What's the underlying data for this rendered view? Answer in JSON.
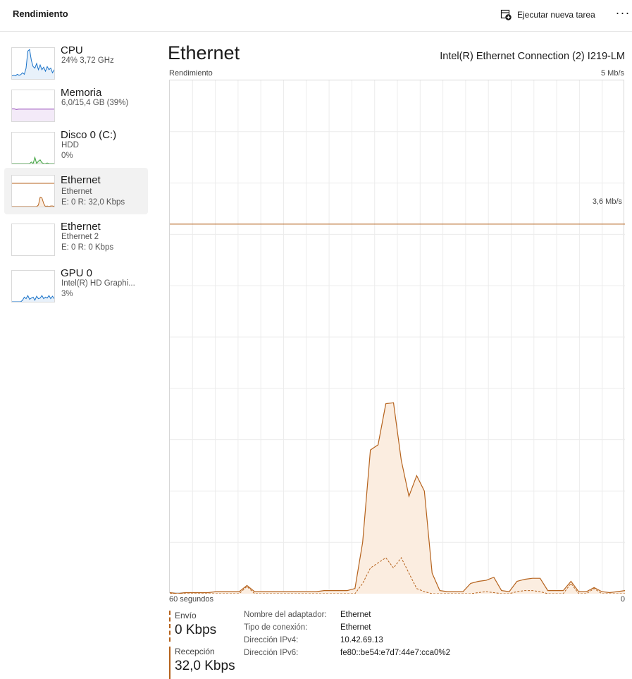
{
  "header": {
    "title": "Rendimiento",
    "run_task_label": "Ejecutar nueva tarea",
    "more_label": "···"
  },
  "sidebar": {
    "items": [
      {
        "name": "CPU",
        "line1": "24%  3,72 GHz",
        "line2": "",
        "color": "#1a73c9",
        "selected": false
      },
      {
        "name": "Memoria",
        "line1": "6,0/15,4 GB (39%)",
        "line2": "",
        "color": "#8e3fb5",
        "selected": false
      },
      {
        "name": "Disco 0 (C:)",
        "line1": "HDD",
        "line2": "0%",
        "color": "#3fa33f",
        "selected": false
      },
      {
        "name": "Ethernet",
        "line1": "Ethernet",
        "line2": "E: 0  R: 32,0 Kbps",
        "color": "#b5621c",
        "selected": true
      },
      {
        "name": "Ethernet",
        "line1": "Ethernet 2",
        "line2": "E: 0  R: 0 Kbps",
        "color": "#b5621c",
        "selected": false
      },
      {
        "name": "GPU 0",
        "line1": "Intel(R) HD Graphi...",
        "line2": "3%",
        "color": "#1a73c9",
        "selected": false
      }
    ]
  },
  "main": {
    "title": "Ethernet",
    "adapter": "Intel(R) Ethernet Connection (2) I219-LM",
    "graph_label": "Rendimiento",
    "max_label": "5 Mb/s",
    "scale_line_label": "3,6 Mb/s",
    "time_label": "60 segundos",
    "zero_label": "0",
    "line_color": "#b5621c",
    "fill_color": "#fbede0",
    "grid_color": "#ececec"
  },
  "chart_data": {
    "type": "area",
    "title": "",
    "xlabel": "60 segundos",
    "ylabel": "Rendimiento",
    "ylim": [
      0,
      5
    ],
    "y_unit": "Mb/s",
    "reference_line": 3.6,
    "x": [
      0,
      1,
      2,
      3,
      4,
      5,
      6,
      7,
      8,
      9,
      10,
      11,
      12,
      13,
      14,
      15,
      16,
      17,
      18,
      19,
      20,
      21,
      22,
      23,
      24,
      25,
      26,
      27,
      28,
      29,
      30,
      31,
      32,
      33,
      34,
      35,
      36,
      37,
      38,
      39,
      40,
      41,
      42,
      43,
      44,
      45,
      46,
      47,
      48,
      49,
      50,
      51,
      52,
      53,
      54,
      55,
      56,
      57,
      58,
      59
    ],
    "series": [
      {
        "name": "Recepción",
        "style": "solid",
        "values": [
          0.01,
          0.0,
          0.01,
          0.01,
          0.01,
          0.01,
          0.02,
          0.02,
          0.02,
          0.02,
          0.08,
          0.02,
          0.02,
          0.02,
          0.02,
          0.02,
          0.02,
          0.02,
          0.02,
          0.02,
          0.03,
          0.03,
          0.03,
          0.03,
          0.05,
          0.5,
          1.4,
          1.45,
          1.85,
          1.86,
          1.3,
          0.95,
          1.15,
          1.0,
          0.2,
          0.03,
          0.02,
          0.02,
          0.02,
          0.1,
          0.12,
          0.13,
          0.16,
          0.03,
          0.02,
          0.12,
          0.14,
          0.15,
          0.15,
          0.03,
          0.03,
          0.03,
          0.12,
          0.02,
          0.02,
          0.06,
          0.02,
          0.01,
          0.02,
          0.03
        ]
      },
      {
        "name": "Envío",
        "style": "dashed",
        "values": [
          0,
          0,
          0,
          0,
          0,
          0,
          0,
          0,
          0,
          0,
          0.07,
          0,
          0,
          0,
          0,
          0,
          0,
          0,
          0,
          0,
          0,
          0,
          0,
          0,
          0,
          0.1,
          0.25,
          0.3,
          0.35,
          0.25,
          0.35,
          0.2,
          0.05,
          0.02,
          0,
          0,
          0,
          0,
          0,
          0,
          0.01,
          0.02,
          0.01,
          0,
          0,
          0.02,
          0.03,
          0.03,
          0.02,
          0,
          0,
          0,
          0.1,
          0,
          0,
          0.05,
          0,
          0,
          0,
          0
        ]
      }
    ]
  },
  "stats": {
    "send_label": "Envío",
    "send_value": "0 Kbps",
    "recv_label": "Recepción",
    "recv_value": "32,0 Kbps",
    "props": [
      {
        "key": "Nombre del adaptador:",
        "value": "Ethernet"
      },
      {
        "key": "Tipo de conexión:",
        "value": "Ethernet"
      },
      {
        "key": "Dirección IPv4:",
        "value": "10.42.69.13"
      },
      {
        "key": "Dirección IPv6:",
        "value": "fe80::be54:e7d7:44e7:cca0%2"
      }
    ]
  }
}
